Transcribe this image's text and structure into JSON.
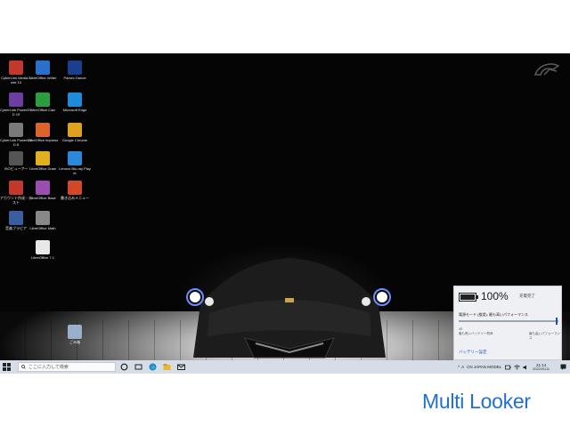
{
  "desktop": {
    "icons": [
      {
        "label": "CyberLink Media Suite 10",
        "icon": "cyberlink-media-icon",
        "color": "#c0392b"
      },
      {
        "label": "LibreOffice Writer",
        "icon": "writer-icon",
        "color": "#2a6fc9"
      },
      {
        "label": "Parsec Dance",
        "icon": "parsec-icon",
        "color": "#1a3f8f"
      },
      {
        "label": "CyberLink PowerDVD 19",
        "icon": "powerdvd-icon",
        "color": "#6a3fa0"
      },
      {
        "label": "LibreOffice Calc",
        "icon": "calc-icon",
        "color": "#2e9d3f"
      },
      {
        "label": "Microsoft Edge",
        "icon": "edge-icon",
        "color": "#1f8ad9"
      },
      {
        "label": "CyberLink PowerDVD 8",
        "icon": "powerdvd8-icon",
        "color": "#7a7a7a"
      },
      {
        "label": "LibreOffice Impress",
        "icon": "impress-icon",
        "color": "#d9652a"
      },
      {
        "label": "Google Chrome",
        "icon": "chrome-icon",
        "color": "#e0a020"
      },
      {
        "label": "ISOビューアー",
        "icon": "iso-viewer-icon",
        "color": "#555555"
      },
      {
        "label": "LibreOffice Draw",
        "icon": "draw-icon",
        "color": "#e0b020"
      },
      {
        "label": "Lenovo Blu-ray Player",
        "icon": "bluray-player-icon",
        "color": "#2a8ad9"
      },
      {
        "label": "アカウント作成・ホスト",
        "icon": "account-icon",
        "color": "#c0392b"
      },
      {
        "label": "LibreOffice Base",
        "icon": "base-icon",
        "color": "#9a4fb0"
      },
      {
        "label": "書き込みメニュー",
        "icon": "burn-menu-icon",
        "color": "#d04a2a"
      },
      {
        "label": "音楽ブラビア",
        "icon": "music-icon",
        "color": "#3a5fa0"
      },
      {
        "label": "LibreOffice Math",
        "icon": "math-icon",
        "color": "#888888"
      },
      {
        "label": "LibreOffice 7.1",
        "icon": "libreoffice-icon",
        "color": "#e8e8e8"
      },
      {
        "label": "ごみ箱",
        "icon": "recycle-bin-icon",
        "color": "#9ab0c8"
      }
    ]
  },
  "taskbar": {
    "search_placeholder": "ここに入力して検索",
    "tray_ime": "A",
    "tray_lang": "CN JAPAN MODEL",
    "time": "21:14",
    "date": "2022/01/11"
  },
  "battery_flyout": {
    "percent": "100%",
    "state": "充電完了",
    "mode_label": "電源モード (推奨): 最も高いパフォーマンス",
    "low_label": "最も長いバッテリー寿命",
    "high_label": "最も高いパフォーマンス",
    "left_label": "45",
    "settings_link": "バッテリー設定",
    "level": 1.0
  },
  "watermark": {
    "text": "Multi Looker"
  },
  "colors": {
    "taskbar": "#d7dde6",
    "flyout": "#eef0f3",
    "accent": "#1f6fd6"
  }
}
